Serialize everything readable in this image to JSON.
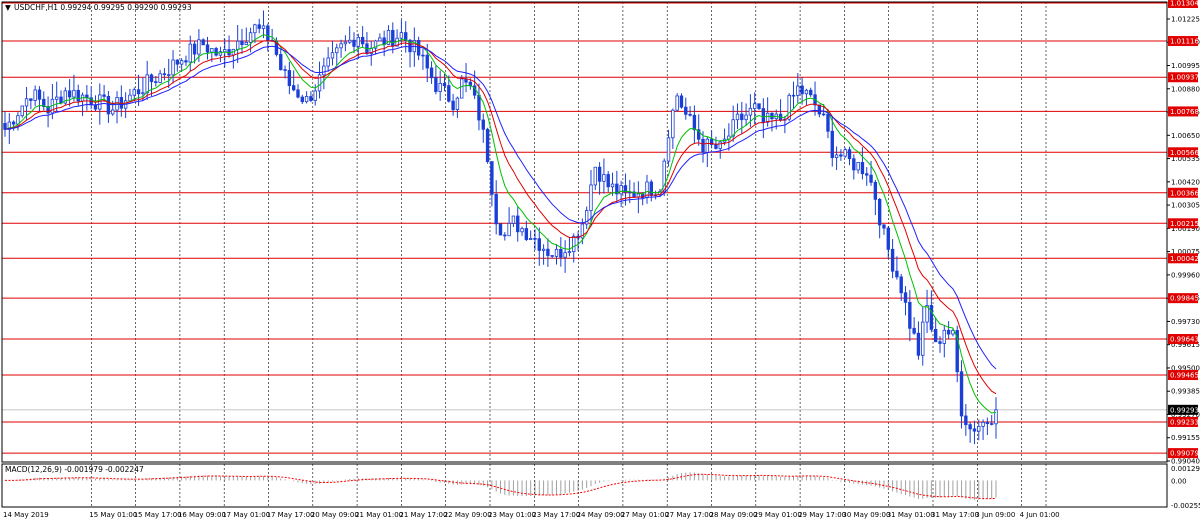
{
  "window": {
    "menu_symbol": "▼",
    "symbol_info": "USDCHF,H1  0.99294 0.99295 0.99290 0.99293"
  },
  "macd": {
    "label": "MACD(12,26,9) -0.001979 -0.002247",
    "ticks": [
      "0.001297",
      "0.00",
      "-0.002559"
    ]
  },
  "chart_data": {
    "type": "candlestick",
    "symbol": "USDCHF",
    "timeframe": "H1",
    "ohlc_header": {
      "open": 0.99294,
      "high": 0.99295,
      "low": 0.9929,
      "close": 0.99293
    },
    "ylim": [
      0.9904,
      1.01304
    ],
    "current_price": "0.99293",
    "price_ticks": [
      "1.01225",
      "1.01110",
      "1.00995",
      "1.00880",
      "1.00765",
      "1.00650",
      "1.00535",
      "1.00420",
      "1.00305",
      "1.00190",
      "1.00075",
      "0.99960",
      "0.99845",
      "0.99730",
      "0.99615",
      "0.99500",
      "0.99385",
      "0.99270",
      "0.99155",
      "0.99040"
    ],
    "horizontal_levels": [
      "1.01304",
      "1.01116",
      "1.00937",
      "1.00768",
      "1.00566",
      "1.00366",
      "1.00215",
      "1.00042",
      "0.99845",
      "0.99643",
      "0.99465",
      "0.99233",
      "0.99079"
    ],
    "x_tick_labels": [
      "14 May 2019",
      "15 May 01:00",
      "15 May 17:00",
      "16 May 09:00",
      "17 May 01:00",
      "17 May 17:00",
      "20 May 09:00",
      "21 May 01:00",
      "21 May 17:00",
      "22 May 09:00",
      "23 May 01:00",
      "23 May 17:00",
      "24 May 09:00",
      "27 May 01:00",
      "27 May 17:00",
      "28 May 09:00",
      "29 May 01:00",
      "29 May 17:00",
      "30 May 09:00",
      "31 May 01:00",
      "31 May 17:00",
      "3 Jun 09:00",
      "4 Jun 01:00"
    ],
    "close_path_keypoints": [
      [
        0,
        1.0068
      ],
      [
        6,
        1.0086
      ],
      [
        10,
        1.0078
      ],
      [
        14,
        1.0087
      ],
      [
        20,
        1.0083
      ],
      [
        25,
        1.0078
      ],
      [
        30,
        1.0086
      ],
      [
        34,
        1.0092
      ],
      [
        38,
        1.0098
      ],
      [
        42,
        1.0105
      ],
      [
        46,
        1.011
      ],
      [
        50,
        1.0104
      ],
      [
        54,
        1.0112
      ],
      [
        58,
        1.0118
      ],
      [
        62,
        1.0112
      ],
      [
        64,
        1.0098
      ],
      [
        66,
        1.009
      ],
      [
        70,
        1.0082
      ],
      [
        74,
        1.0096
      ],
      [
        78,
        1.0108
      ],
      [
        82,
        1.0115
      ],
      [
        84,
        1.0108
      ],
      [
        88,
        1.0112
      ],
      [
        92,
        1.0115
      ],
      [
        96,
        1.0105
      ],
      [
        100,
        1.009
      ],
      [
        104,
        1.0082
      ],
      [
        106,
        1.0091
      ],
      [
        108,
        1.0088
      ],
      [
        110,
        1.0075
      ],
      [
        112,
        1.0055
      ],
      [
        114,
        1.0025
      ],
      [
        116,
        1.0015
      ],
      [
        118,
        1.0022
      ],
      [
        122,
        1.0016
      ],
      [
        126,
        1.0008
      ],
      [
        128,
        1.0006
      ],
      [
        132,
        1.0014
      ],
      [
        134,
        1.0022
      ],
      [
        137,
        1.005
      ],
      [
        140,
        1.004
      ],
      [
        144,
        1.0035
      ],
      [
        148,
        1.0038
      ],
      [
        152,
        1.004
      ],
      [
        154,
        1.0068
      ],
      [
        156,
        1.0085
      ],
      [
        158,
        1.0075
      ],
      [
        162,
        1.006
      ],
      [
        166,
        1.0058
      ],
      [
        170,
        1.0072
      ],
      [
        174,
        1.0078
      ],
      [
        176,
        1.0071
      ],
      [
        180,
        1.0073
      ],
      [
        184,
        1.0088
      ],
      [
        186,
        1.0085
      ],
      [
        188,
        1.008
      ],
      [
        190,
        1.0072
      ],
      [
        192,
        1.0058
      ],
      [
        196,
        1.0052
      ],
      [
        200,
        1.0048
      ],
      [
        202,
        1.0035
      ],
      [
        204,
        1.0015
      ],
      [
        206,
        1.0002
      ],
      [
        208,
        0.999
      ],
      [
        210,
        0.9972
      ],
      [
        212,
        0.9958
      ],
      [
        214,
        0.998
      ],
      [
        216,
        0.996
      ],
      [
        218,
        0.997
      ],
      [
        220,
        0.9965
      ],
      [
        222,
        0.993
      ],
      [
        224,
        0.992
      ],
      [
        226,
        0.9922
      ],
      [
        228,
        0.9924
      ],
      [
        230,
        0.99293
      ]
    ],
    "moving_averages": [
      {
        "color": "#00c000",
        "period": 8
      },
      {
        "color": "#e00000",
        "period": 14
      },
      {
        "color": "#2020ff",
        "period": 21
      }
    ],
    "bull_color": "#1a3fd8",
    "bear_color": "#1a3fd8",
    "macd_color": "#ff0000",
    "hist_color": "#a0a0a0"
  }
}
